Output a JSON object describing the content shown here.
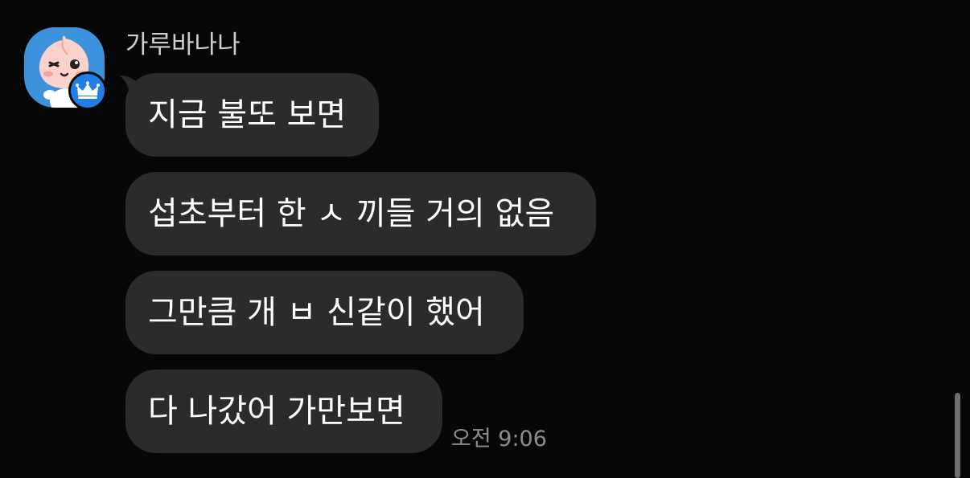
{
  "chat": {
    "sender_name": "가루바나나",
    "avatar_icon": "apeach-crown-icon",
    "messages": [
      {
        "text": "지금 불또 보면"
      },
      {
        "text": "섭초부터 한 ㅅ 끼들 거의 없음"
      },
      {
        "text": "그만큼 개 ㅂ 신같이 했어"
      },
      {
        "text": "다 나갔어 가만보면"
      }
    ],
    "timestamp": "오전 9:06"
  },
  "colors": {
    "background": "#070707",
    "bubble": "#2b2b2b",
    "avatar_bg": "#3d93db",
    "badge": "#1f7fe6",
    "timestamp": "#8d8d8d"
  }
}
